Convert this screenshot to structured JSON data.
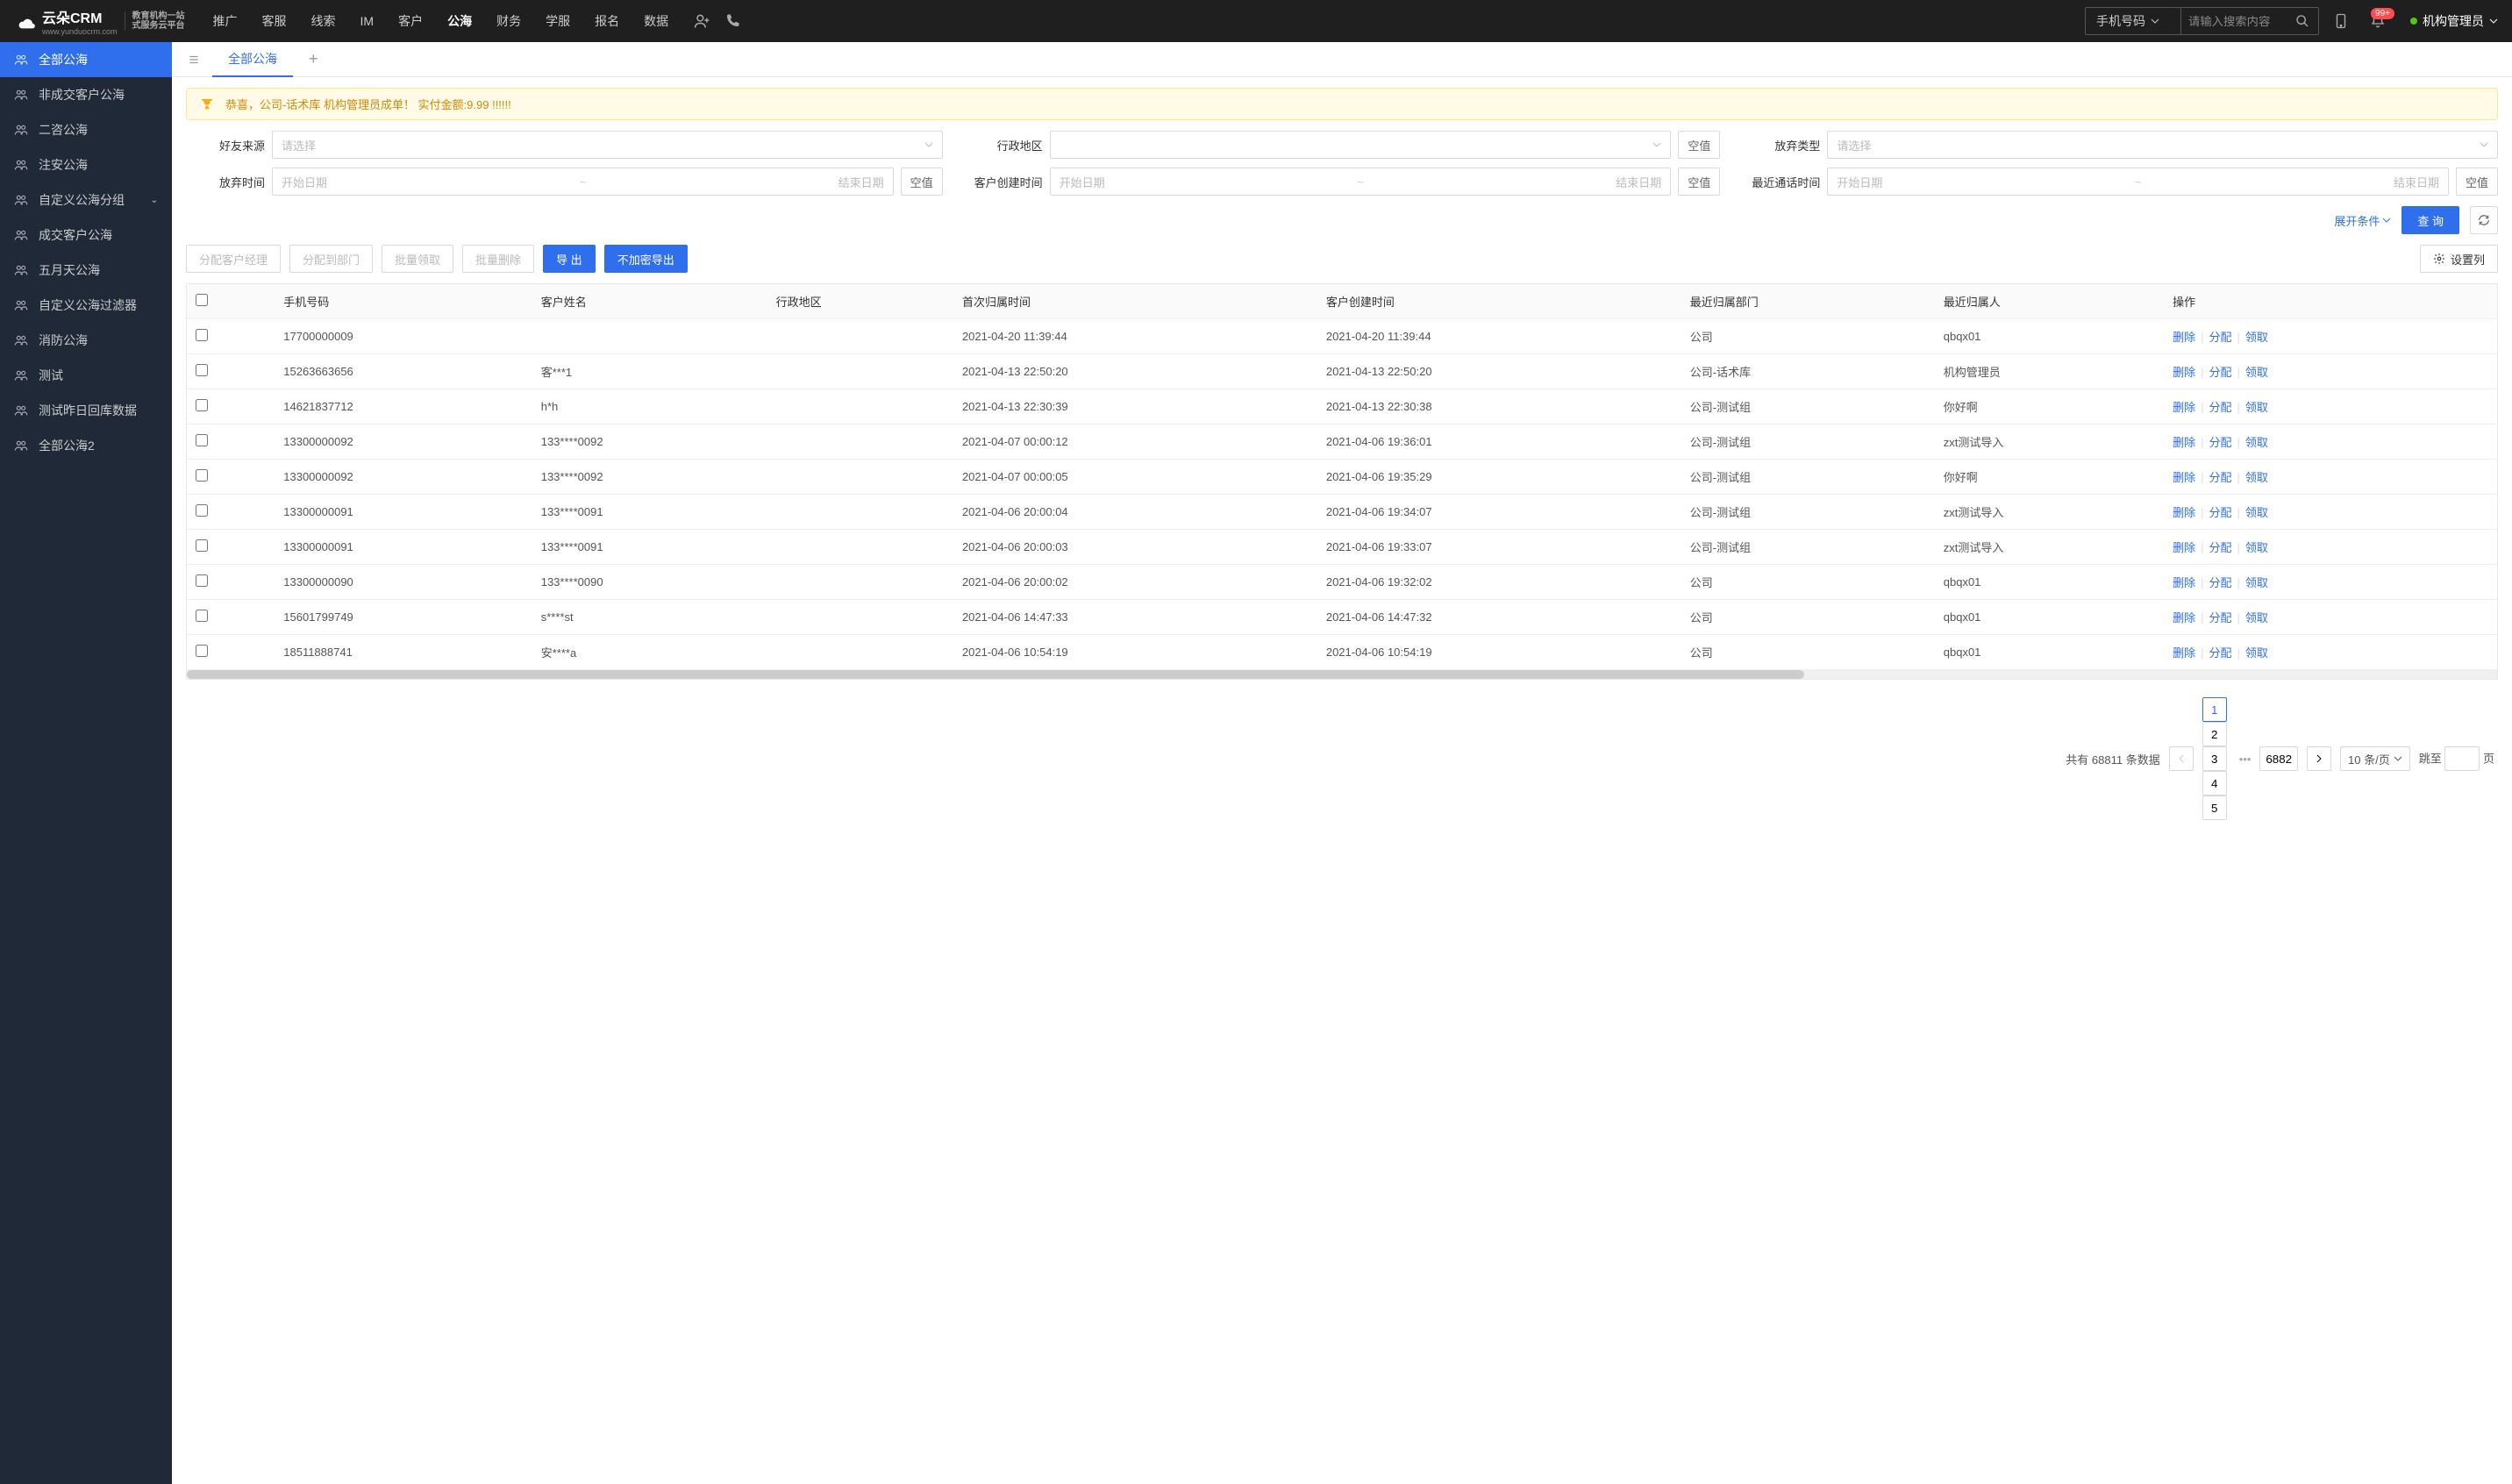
{
  "logo": {
    "brand": "云朵CRM",
    "brand_sub": "www.yunduocrm.com",
    "tagline_line1": "教育机构一站",
    "tagline_line2": "式服务云平台"
  },
  "top_nav": [
    "推广",
    "客服",
    "线索",
    "IM",
    "客户",
    "公海",
    "财务",
    "学服",
    "报名",
    "数据"
  ],
  "top_nav_active": "公海",
  "search": {
    "type": "手机号码",
    "placeholder": "请输入搜索内容"
  },
  "notif_badge": "99+",
  "user_name": "机构管理员",
  "sidebar": [
    {
      "label": "全部公海",
      "active": true
    },
    {
      "label": "非成交客户公海"
    },
    {
      "label": "二咨公海"
    },
    {
      "label": "注安公海"
    },
    {
      "label": "自定义公海分组",
      "has_children": true
    },
    {
      "label": "成交客户公海"
    },
    {
      "label": "五月天公海"
    },
    {
      "label": "自定义公海过滤器"
    },
    {
      "label": "消防公海"
    },
    {
      "label": "测试"
    },
    {
      "label": "测试昨日回库数据"
    },
    {
      "label": "全部公海2"
    }
  ],
  "tabs": {
    "active": "全部公海"
  },
  "banner": "恭喜，公司-话术库  机构管理员成单！  实付金额:9.99 !!!!!!",
  "filters": {
    "source_label": "好友来源",
    "source_placeholder": "请选择",
    "region_label": "行政地区",
    "empty_btn": "空值",
    "abandon_type_label": "放弃类型",
    "abandon_type_placeholder": "请选择",
    "abandon_time_label": "放弃时间",
    "start_placeholder": "开始日期",
    "end_placeholder": "结束日期",
    "create_time_label": "客户创建时间",
    "last_call_label": "最近通话时间",
    "expand": "展开条件",
    "search_btn": "查 询"
  },
  "toolbar": {
    "assign_manager": "分配客户经理",
    "assign_dept": "分配到部门",
    "batch_claim": "批量领取",
    "batch_delete": "批量删除",
    "export": "导 出",
    "export_plain": "不加密导出",
    "set_columns": "设置列"
  },
  "table": {
    "columns": [
      "手机号码",
      "客户姓名",
      "行政地区",
      "首次归属时间",
      "客户创建时间",
      "最近归属部门",
      "最近归属人",
      "操作"
    ],
    "ops": [
      "删除",
      "分配",
      "领取"
    ],
    "rows": [
      {
        "phone": "17700000009",
        "name": "",
        "region": "",
        "first_time": "2021-04-20 11:39:44",
        "create_time": "2021-04-20 11:39:44",
        "dept": "公司",
        "owner": "qbqx01"
      },
      {
        "phone": "15263663656",
        "name": "客***1",
        "region": "",
        "first_time": "2021-04-13 22:50:20",
        "create_time": "2021-04-13 22:50:20",
        "dept": "公司-话术库",
        "owner": "机构管理员"
      },
      {
        "phone": "14621837712",
        "name": "h*h",
        "region": "",
        "first_time": "2021-04-13 22:30:39",
        "create_time": "2021-04-13 22:30:38",
        "dept": "公司-测试组",
        "owner": "你好啊"
      },
      {
        "phone": "13300000092",
        "name": "133****0092",
        "region": "",
        "first_time": "2021-04-07 00:00:12",
        "create_time": "2021-04-06 19:36:01",
        "dept": "公司-测试组",
        "owner": "zxt测试导入"
      },
      {
        "phone": "13300000092",
        "name": "133****0092",
        "region": "",
        "first_time": "2021-04-07 00:00:05",
        "create_time": "2021-04-06 19:35:29",
        "dept": "公司-测试组",
        "owner": "你好啊"
      },
      {
        "phone": "13300000091",
        "name": "133****0091",
        "region": "",
        "first_time": "2021-04-06 20:00:04",
        "create_time": "2021-04-06 19:34:07",
        "dept": "公司-测试组",
        "owner": "zxt测试导入"
      },
      {
        "phone": "13300000091",
        "name": "133****0091",
        "region": "",
        "first_time": "2021-04-06 20:00:03",
        "create_time": "2021-04-06 19:33:07",
        "dept": "公司-测试组",
        "owner": "zxt测试导入"
      },
      {
        "phone": "13300000090",
        "name": "133****0090",
        "region": "",
        "first_time": "2021-04-06 20:00:02",
        "create_time": "2021-04-06 19:32:02",
        "dept": "公司",
        "owner": "qbqx01"
      },
      {
        "phone": "15601799749",
        "name": "s****st",
        "region": "",
        "first_time": "2021-04-06 14:47:33",
        "create_time": "2021-04-06 14:47:32",
        "dept": "公司",
        "owner": "qbqx01"
      },
      {
        "phone": "18511888741",
        "name": "安****a",
        "region": "",
        "first_time": "2021-04-06 10:54:19",
        "create_time": "2021-04-06 10:54:19",
        "dept": "公司",
        "owner": "qbqx01"
      }
    ]
  },
  "pagination": {
    "total_prefix": "共有",
    "total": "68811",
    "total_suffix": "条数据",
    "pages": [
      "1",
      "2",
      "3",
      "4",
      "5"
    ],
    "ellipsis": "•••",
    "last": "6882",
    "size": "10 条/页",
    "jump_label": "跳至",
    "jump_suffix": "页"
  }
}
